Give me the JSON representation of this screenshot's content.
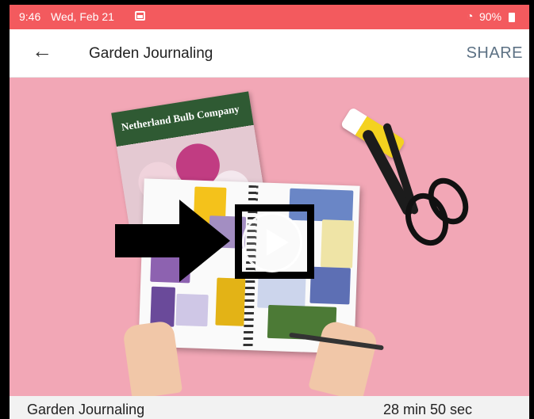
{
  "status_bar": {
    "time": "9:46",
    "date": "Wed, Feb 21",
    "battery": "90%",
    "icons": [
      "image-notification-icon",
      "wifi-icon",
      "battery-icon"
    ]
  },
  "app_bar": {
    "back_icon": "arrow-left-icon",
    "title": "Garden Journaling",
    "share_label": "SHARE"
  },
  "video": {
    "catalog_text": "Netherland Bulb Company",
    "play_icon": "play-icon",
    "annotation_icon": "arrow-right-icon"
  },
  "footer": {
    "title": "Garden Journaling",
    "duration": "28 min 50 sec"
  },
  "colors": {
    "status_bar": "#f35a5e",
    "share": "#5c7184",
    "video_background": "#f2a7b6"
  }
}
